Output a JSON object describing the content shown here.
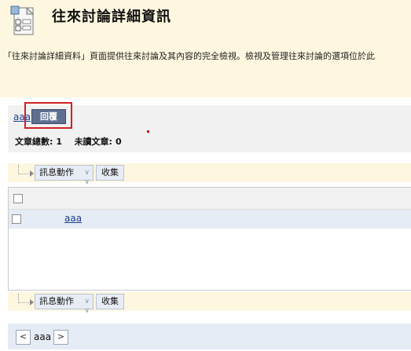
{
  "header": {
    "title": "往來討論詳細資訊",
    "description": "「往來討論詳細資料」頁面提供往來討論及其內容的完全檢視。檢視及管理往來討論的選項位於此"
  },
  "reply_bar": {
    "thread_link": "aaa",
    "reply_label": "回覆",
    "total_label": "文章總數:",
    "total_value": "1",
    "unread_label": "未讀文章:",
    "unread_value": "0"
  },
  "actions": {
    "message_actions": "訊息動作",
    "collect": "收集"
  },
  "list": {
    "rows": [
      {
        "subject": "aaa"
      }
    ]
  },
  "pager": {
    "prev_glyph": "<",
    "current": "aaa",
    "next_glyph": ">"
  },
  "colors": {
    "header_bg": "#fef7df",
    "highlight": "#d21f27",
    "reply_button": "#5e6f90",
    "row_bg": "#e6ecf5"
  },
  "icons": [
    "discussion-board-icon",
    "chevron-down-icon",
    "tree-connector-icon"
  ]
}
